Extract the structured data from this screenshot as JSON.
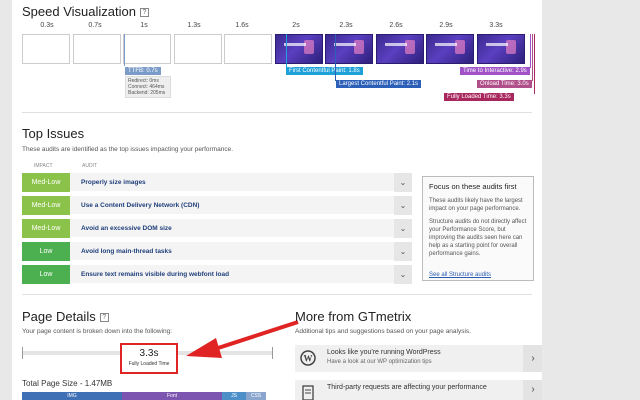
{
  "speed": {
    "title": "Speed Visualization",
    "help": "?",
    "ticks": [
      "0.3s",
      "0.7s",
      "1s",
      "1.3s",
      "1.6s",
      "2s",
      "2.3s",
      "2.6s",
      "2.9s",
      "3.3s"
    ],
    "ttfb": {
      "label": "TTFB: 0.7s",
      "redirect": "Redirect: 0ms",
      "connect": "Connect: 464ms",
      "backend": "Backend: 205ms"
    },
    "markers": {
      "fcp": "First Contentful Paint: 1.8s",
      "lcp": "Largest Contentful Paint: 2.1s",
      "tti": "Time to Interactive: 2.9s",
      "onload": "Onload Time: 3.0s",
      "fully": "Fully Loaded Time: 3.3s"
    },
    "colors": {
      "ttfb": "#7b9bc8",
      "fcp": "#1ea0d8",
      "lcp": "#2b5fb8",
      "tti": "#a052c6",
      "onload": "#b04f8a",
      "fully": "#a8275c"
    }
  },
  "issues": {
    "title": "Top Issues",
    "subtitle": "These audits are identified as the top issues impacting your performance.",
    "col_impact": "IMPACT",
    "col_audit": "AUDIT",
    "rows": [
      {
        "impact": "Med-Low",
        "color": "#8bc34a",
        "audit": "Properly size images"
      },
      {
        "impact": "Med-Low",
        "color": "#8bc34a",
        "audit": "Use a Content Delivery Network (CDN)"
      },
      {
        "impact": "Med-Low",
        "color": "#8bc34a",
        "audit": "Avoid an excessive DOM size"
      },
      {
        "impact": "Low",
        "color": "#4caf50",
        "audit": "Avoid long main-thread tasks"
      },
      {
        "impact": "Low",
        "color": "#4caf50",
        "audit": "Ensure text remains visible during webfont load"
      }
    ],
    "focus": {
      "title": "Focus on these audits first",
      "p1": "These audits likely have the largest impact on your page performance.",
      "p2": "Structure audits do not directly affect your Performance Score, but improving the audits seen here can help as a starting point for overall performance gains.",
      "link": "See all Structure audits"
    }
  },
  "details": {
    "title": "Page Details",
    "help": "?",
    "subtitle": "Your page content is broken down into the following:",
    "fully_value": "3.3s",
    "fully_label": "Fully Loaded Time",
    "total_size": "Total Page Size - 1.47MB",
    "bar": [
      {
        "label": "IMG",
        "color": "#3f6fb5"
      },
      {
        "label": "Font",
        "color": "#7b55b0"
      },
      {
        "label": "JS",
        "color": "#4d8fc9"
      },
      {
        "label": "CSS",
        "color": "#8aa6cf"
      }
    ]
  },
  "more": {
    "title": "More from GTmetrix",
    "subtitle": "Additional tips and suggestions based on your page analysis.",
    "items": [
      {
        "title": "Looks like you're running WordPress",
        "sub": "Have a look at our WP optimization tips"
      },
      {
        "title": "Third-party requests are affecting your performance",
        "sub": ""
      }
    ]
  }
}
